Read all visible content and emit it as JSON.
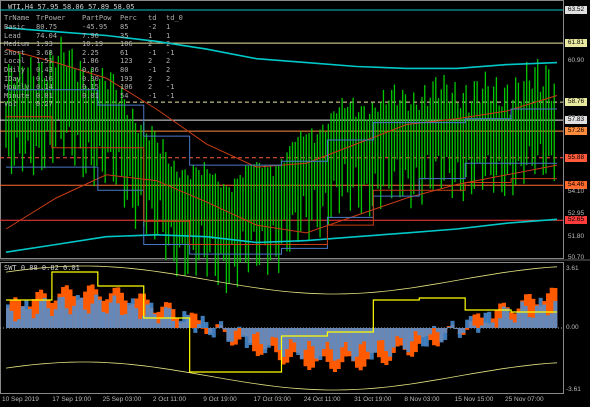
{
  "window": {
    "title": "WTI,H4  57.95 58.06 57.89 58.05"
  },
  "table": {
    "header": [
      "TrName",
      "TrPower",
      "PartPow",
      "Perc",
      "td",
      "td_0"
    ],
    "rows": [
      [
        "Basic",
        "80.75",
        "-45.95",
        "85",
        "-2",
        "1"
      ],
      [
        "Lead",
        "74.04",
        "7.96",
        "35",
        "1",
        "1"
      ],
      [
        "Medium",
        "1.93",
        "10.19",
        "106",
        "2",
        "2"
      ],
      [
        "Short",
        "3.68",
        "2.25",
        "61",
        "-1",
        "-1"
      ],
      [
        "Local",
        "1.51",
        "1.86",
        "123",
        "2",
        "2"
      ],
      [
        "Daily",
        "0.43",
        "0.36",
        "80",
        "-1",
        "2"
      ],
      [
        "IDay",
        "0.16",
        "0.30",
        "193",
        "2",
        "2"
      ],
      [
        "Hourly",
        "0.14",
        "0.15",
        "106",
        "2",
        "-1"
      ],
      [
        "Minute",
        "0.01",
        "0.01",
        "54",
        "-1",
        "-1"
      ],
      [
        "Vol",
        "0.27",
        "",
        "",
        "",
        ""
      ]
    ]
  },
  "price_axis": {
    "labels": [
      "63.52",
      "61.81",
      "60.90",
      "58.76",
      "57.89",
      "57.83",
      "57.26",
      "55.88",
      "54.46",
      "54.10",
      "52.95",
      "52.65",
      "51.80",
      "50.70"
    ],
    "highlighted": [
      {
        "text": "63.52",
        "color": "#e0e0e0"
      },
      {
        "text": "61.81",
        "color": "#e8e8a0"
      },
      {
        "text": "58.76",
        "color": "#e8e8a0"
      },
      {
        "text": "57.83",
        "color": "#e0e0e0"
      },
      {
        "text": "57.26",
        "color": "#ff8c3c"
      },
      {
        "text": "55.88",
        "color": "#ff5a3c"
      },
      {
        "text": "54.46",
        "color": "#ff6a2c"
      },
      {
        "text": "52.65",
        "color": "#ff3c3c"
      }
    ]
  },
  "indicator": {
    "title": "SWT 0.88 0.82 0.01",
    "axis_labels": [
      "3.61",
      "0.00",
      "-3.61"
    ]
  },
  "time_axis": [
    "10 Sep 2019",
    "17 Sep 19:00",
    "25 Sep 03:00",
    "2 Oct 11:00",
    "9 Oct 19:00",
    "17 Oct 03:00",
    "24 Oct 11:00",
    "31 Oct 19:00",
    "8 Nov 03:00",
    "15 Nov 15:00",
    "25 Nov 07:00"
  ],
  "colors": {
    "background": "#000000",
    "candles": "#00c800",
    "ma_cyan": "#00c8c8",
    "ma_brown": "#c83c14",
    "level_yellow": "#e8e8a0",
    "hist_orange": "#ff5a00",
    "hist_blue": "#4a90d9",
    "osc_yellow": "#ffff00"
  },
  "chart_data": {
    "type": "line",
    "title": "WTI,H4",
    "ohlc_last": {
      "open": 57.95,
      "high": 58.06,
      "low": 57.89,
      "close": 58.05
    },
    "ylim": [
      50.7,
      63.52
    ],
    "levels": [
      {
        "value": 63.52,
        "color": "#e0e0e0"
      },
      {
        "value": 61.81,
        "color": "#e8e8a0"
      },
      {
        "value": 58.76,
        "color": "#e8e8a0"
      },
      {
        "value": 57.83,
        "color": "#e0e0e0"
      },
      {
        "value": 57.26,
        "color": "#ff8c3c"
      },
      {
        "value": 55.88,
        "color": "#ff5a3c"
      },
      {
        "value": 54.46,
        "color": "#ff6a2c"
      },
      {
        "value": 52.65,
        "color": "#ff3c3c"
      }
    ],
    "x": [
      "10 Sep 2019",
      "17 Sep 19:00",
      "25 Sep 03:00",
      "2 Oct 11:00",
      "9 Oct 19:00",
      "17 Oct 03:00",
      "24 Oct 11:00",
      "31 Oct 19:00",
      "8 Nov 03:00",
      "15 Nov 15:00",
      "25 Nov 07:00"
    ],
    "series": [
      {
        "values": [
          57.6,
          58.9,
          57.2,
          53.4,
          52.4,
          53.6,
          56.0,
          56.6,
          57.1,
          57.0,
          58.0
        ]
      }
    ]
  }
}
